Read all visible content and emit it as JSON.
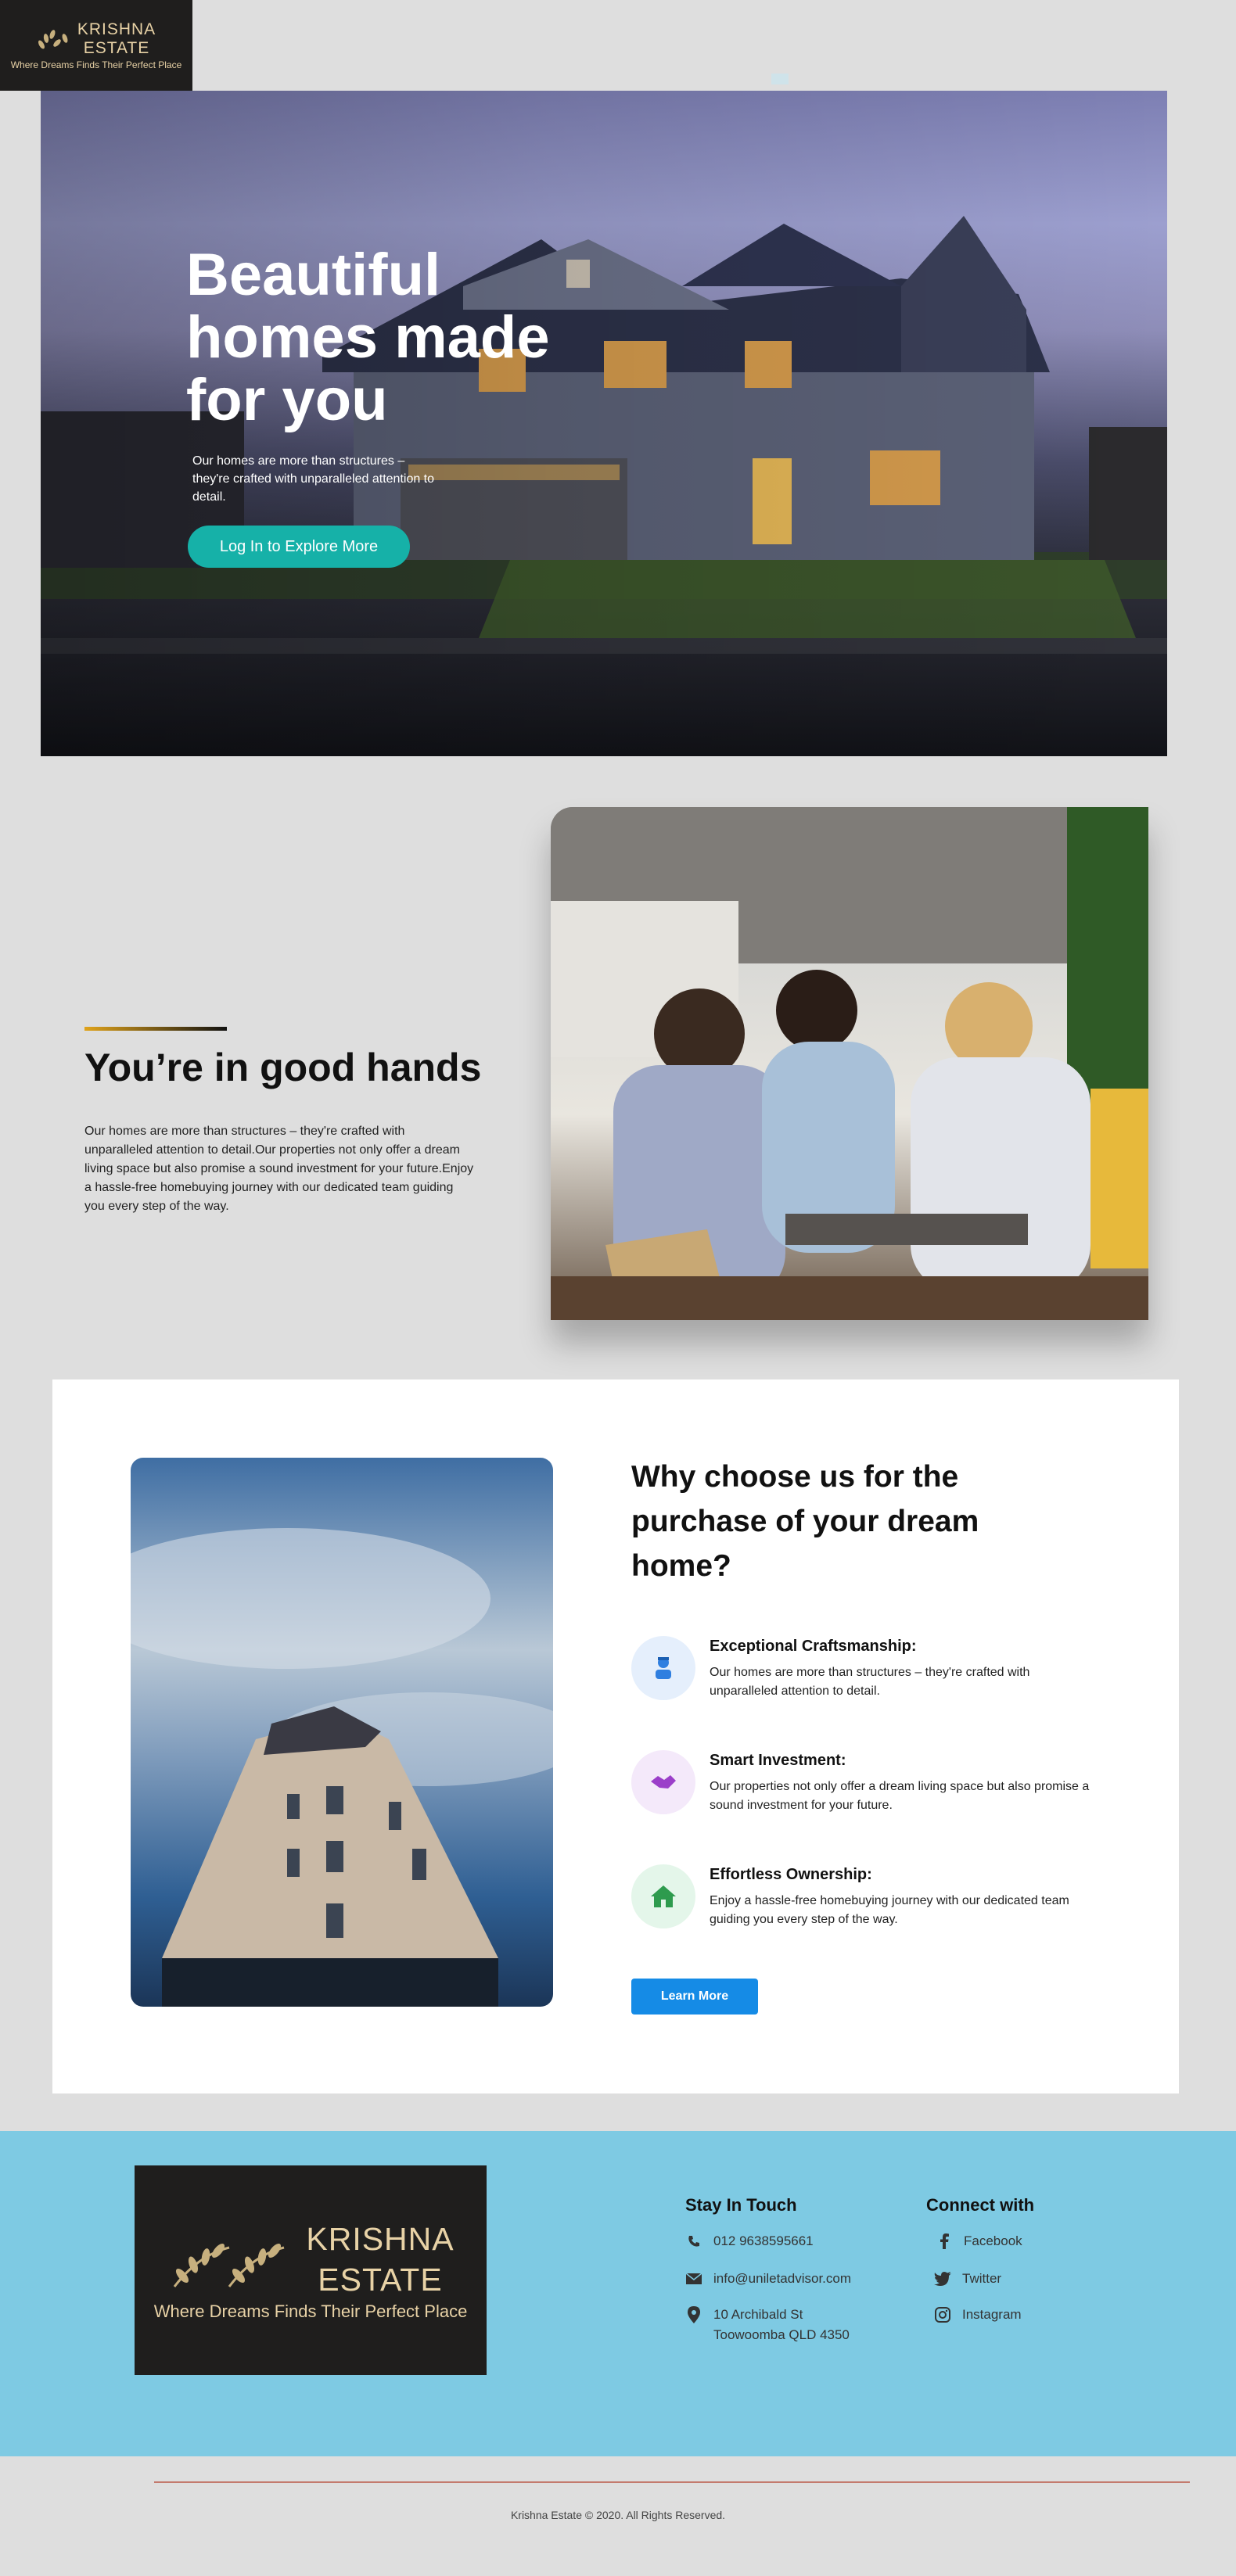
{
  "brand": {
    "name_line1": "KRISHNA",
    "name_line2": "ESTATE",
    "tagline": "Where Dreams Finds Their Perfect Place",
    "gold": "#e8d2a6"
  },
  "hero": {
    "title": "Beautiful homes made for you",
    "subtitle": "Our homes are more than structures – they're crafted with unparalleled attention to detail.",
    "cta": "Log In to Explore More",
    "cta_color": "#16b1a8"
  },
  "good_hands": {
    "title": "You’re in good hands",
    "text": "Our homes are more than structures – they're crafted with unparalleled attention to detail.Our properties not only offer a dream living space but also promise a sound investment for your future.Enjoy a hassle-free homebuying journey with our dedicated team guiding you every step of the way."
  },
  "why": {
    "title": "Why choose us for the purchase of your dream home?",
    "features": [
      {
        "title": "Exceptional Craftsmanship:",
        "text": "Our homes are more than structures – they're crafted with unparalleled attention to detail.",
        "icon": "worker-icon"
      },
      {
        "title": "Smart Investment:",
        "text": "Our properties not only offer a dream living space but also promise a sound investment for your future.",
        "icon": "handshake-icon"
      },
      {
        "title": "Effortless Ownership:",
        "text": "Enjoy a hassle-free homebuying journey with our dedicated team guiding you every step of the way.",
        "icon": "home-icon"
      }
    ],
    "button": "Learn More",
    "button_color": "#158be6"
  },
  "footer": {
    "stay_heading": "Stay In Touch",
    "phone": "012 9638595661",
    "email": "info@uniletadvisor.com",
    "address_line1": "10 Archibald St",
    "address_line2": "Toowoomba QLD 4350",
    "connect_heading": "Connect with",
    "social": [
      "Facebook",
      "Twitter",
      "Instagram"
    ],
    "background": "#7ecae3",
    "copyright": "Krishna Estate © 2020. All Rights Reserved."
  }
}
